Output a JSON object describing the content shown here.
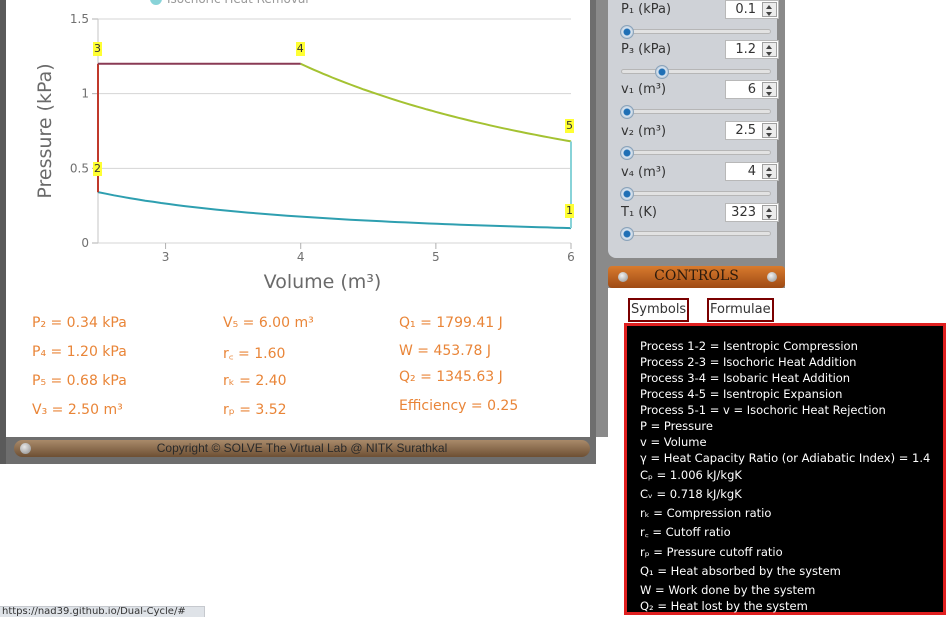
{
  "chart_data": {
    "type": "line",
    "legend": [
      "Isochoric Heat Removal"
    ],
    "ylabel": "Pressure (kPa)",
    "xlabel": "Volume (m³)",
    "xlim": [
      2.5,
      6
    ],
    "ylim": [
      0,
      1.5
    ],
    "x_ticks": [
      "3",
      "4",
      "5",
      "6"
    ],
    "y_ticks": [
      "0",
      "0.5",
      "1",
      "1.5"
    ],
    "grid": true,
    "states": [
      {
        "label": "1",
        "v": 6.0,
        "p": 0.1
      },
      {
        "label": "2",
        "v": 2.5,
        "p": 0.34
      },
      {
        "label": "3",
        "v": 2.5,
        "p": 1.2
      },
      {
        "label": "4",
        "v": 4.0,
        "p": 1.2
      },
      {
        "label": "5",
        "v": 6.0,
        "p": 0.68
      }
    ],
    "gamma": 1.4,
    "series": [
      {
        "process": "1-2",
        "type": "isentropic",
        "color": "#2e9fb0"
      },
      {
        "process": "2-3",
        "type": "isochoric",
        "color": "#c0392b"
      },
      {
        "process": "3-4",
        "type": "isobaric",
        "color": "#8a3a55"
      },
      {
        "process": "4-5",
        "type": "isentropic",
        "color": "#a4c232"
      },
      {
        "process": "5-1",
        "type": "isochoric",
        "color": "#88d3d8"
      }
    ]
  },
  "results": {
    "p2": "P₂ = 0.34 kPa",
    "p4": "P₄ = 1.20 kPa",
    "p5": "P₅ = 0.68 kPa",
    "v3": "V₃ = 2.50 m³",
    "v5": "V₅ = 6.00 m³",
    "rc": "r꜀ = 1.60",
    "rk": "rₖ = 2.40",
    "rp": "rₚ = 3.52",
    "q1": "Q₁ = 1799.41 J",
    "w": "W = 453.78 J",
    "q2": "Q₂ = 1345.63 J",
    "efficiency": "Efficiency = 0.25"
  },
  "status": {
    "copyright": "Copyright © SOLVE The Virtual Lab @ NITK Surathkal"
  },
  "params": [
    {
      "label": "P₁ (kPa)",
      "value": "0.1",
      "fraction": 0.0
    },
    {
      "label": "P₃ (kPa)",
      "value": "1.2",
      "fraction": 0.26
    },
    {
      "label": "v₁ (m³)",
      "value": "6",
      "fraction": 0.0
    },
    {
      "label": "v₂ (m³)",
      "value": "2.5",
      "fraction": 0.0
    },
    {
      "label": "v₄ (m³)",
      "value": "4",
      "fraction": 0.0
    },
    {
      "label": "T₁ (K)",
      "value": "323",
      "fraction": 0.0
    }
  ],
  "controls": {
    "title": "CONTROLS",
    "symbols_button": "Symbols",
    "formulae_button": "Formulae"
  },
  "symbols_list": [
    "Process 1-2 = Isentropic Compression",
    "Process 2-3 = Isochoric Heat Addition",
    "Process 3-4 = Isobaric Heat Addition",
    "Process 4-5 = Isentropic Expansion",
    "Process 5-1 = v = Isochoric Heat Rejection",
    "P = Pressure",
    "v = Volume",
    "γ = Heat Capacity Ratio (or Adiabatic Index) = 1.4",
    "Cₚ = 1.006 kJ/kgK",
    "Cᵥ = 0.718 kJ/kgK",
    "rₖ = Compression ratio",
    "r꜀ = Cutoff ratio",
    "rₚ = Pressure cutoff ratio",
    "Q₁ = Heat absorbed by the system",
    "W = Work done by the system",
    "Q₂ = Heat lost by the system"
  ],
  "browser": {
    "status_url": "https://nad39.github.io/Dual-Cycle/#"
  },
  "colors": {
    "result_text": "#e98538",
    "frame": "#6e6e6e",
    "controls_bar": "#c8651f",
    "formula_border": "#e02020",
    "label_highlight": "#ffff33"
  }
}
